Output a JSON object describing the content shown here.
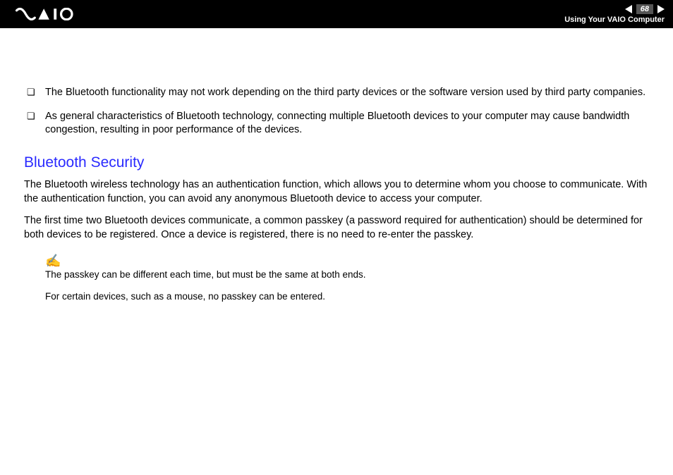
{
  "header": {
    "page_number": "68",
    "section": "Using Your VAIO Computer"
  },
  "bullets": [
    "The Bluetooth functionality may not work depending on the third party devices or the software version used by third party companies.",
    "As general characteristics of Bluetooth technology, connecting multiple Bluetooth devices to your computer may cause bandwidth congestion, resulting in poor performance of the devices."
  ],
  "heading": "Bluetooth Security",
  "paragraphs": [
    "The Bluetooth wireless technology has an authentication function, which allows you to determine whom you choose to communicate. With the authentication function, you can avoid any anonymous Bluetooth device to access your computer.",
    "The first time two Bluetooth devices communicate, a common passkey (a password required for authentication) should be determined for both devices to be registered. Once a device is registered, there is no need to re-enter the passkey."
  ],
  "note_icon": "✍",
  "notes": [
    "The passkey can be different each time, but must be the same at both ends.",
    "For certain devices, such as a mouse, no passkey can be entered."
  ]
}
